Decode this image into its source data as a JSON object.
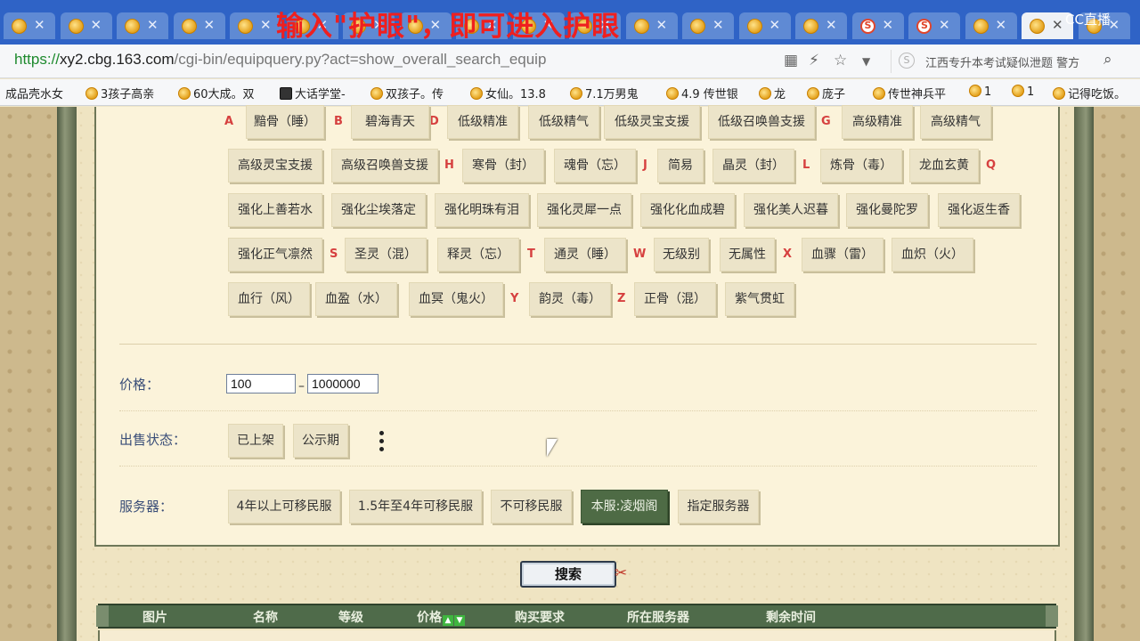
{
  "overlay_text": "输入\"护眼\"，即可进入护眼",
  "logo_text": "CC直播",
  "tabs": [
    {
      "icon": "favicon-icon"
    },
    {
      "icon": "favicon-icon"
    },
    {
      "icon": "favicon-icon"
    },
    {
      "icon": "favicon-icon"
    },
    {
      "icon": "favicon-icon"
    },
    {
      "icon": "favicon-icon"
    },
    {
      "icon": "favicon-icon"
    },
    {
      "icon": "favicon-icon"
    },
    {
      "icon": "favicon-icon"
    },
    {
      "icon": "favicon-icon"
    },
    {
      "icon": "favicon-icon"
    },
    {
      "icon": "favicon-icon"
    },
    {
      "icon": "favicon-icon"
    },
    {
      "icon": "favicon-icon"
    },
    {
      "icon": "favicon-icon"
    },
    {
      "icon": "favicon-icon"
    },
    {
      "icon": "favicon-icon"
    },
    {
      "icon": "favicon-icon"
    },
    {
      "icon": "favicon-icon"
    },
    {
      "icon": "favicon-icon"
    }
  ],
  "address": {
    "https": "https://",
    "host": "xy2.cbg.163.com",
    "path": "/cgi-bin/equipquery.py?act=show_overall_search_equip"
  },
  "search_box": {
    "text": "江西专升本考试疑似泄题 警方"
  },
  "bookmarks": [
    "成品壳水女",
    "3孩子高亲",
    "60大成。双",
    "大话学堂-",
    "双孩子。传",
    "女仙。13.8",
    "7.1万男鬼",
    "4.9 传世银",
    "龙",
    "庞子",
    "传世神兵平",
    "1",
    "1",
    "记得吃饭。"
  ],
  "attributes": {
    "letters": [
      "A",
      "B",
      "D",
      "G",
      "H",
      "J",
      "L",
      "Q",
      "S",
      "T",
      "W",
      "X",
      "Y",
      "Z"
    ],
    "buttons": [
      "黯骨（睡）",
      "碧海青天",
      "低级精准",
      "低级精气",
      "低级灵宝支援",
      "低级召唤兽支援",
      "高级精准",
      "高级精气",
      "高级灵宝支援",
      "高级召唤兽支援",
      "寒骨（封）",
      "魂骨（忘）",
      "简易",
      "晶灵（封）",
      "炼骨（毒）",
      "龙血玄黄",
      "强化上善若水",
      "强化尘埃落定",
      "强化明珠有泪",
      "强化灵犀一点",
      "强化化血成碧",
      "强化美人迟暮",
      "强化曼陀罗",
      "强化返生香",
      "强化正气凛然",
      "圣灵（混）",
      "释灵（忘）",
      "通灵（睡）",
      "无级别",
      "无属性",
      "血骤（雷）",
      "血炽（火）",
      "血行（风）",
      "血盈（水）",
      "血冥（鬼火）",
      "韵灵（毒）",
      "正骨（混）",
      "紫气贯虹"
    ]
  },
  "price": {
    "label": "价格：",
    "min": "100",
    "max": "1000000",
    "separator": "–"
  },
  "sale_status": {
    "label": "出售状态：",
    "options": [
      "已上架",
      "公示期"
    ]
  },
  "server": {
    "label": "服务器：",
    "options": [
      "4年以上可移民服",
      "1.5年至4年可移民服",
      "不可移民服",
      "本服:凌烟阁",
      "指定服务器"
    ],
    "selected": "本服:凌烟阁"
  },
  "search_button": "搜索",
  "results_header": [
    "图片",
    "名称",
    "等级",
    "价格",
    "购买要求",
    "所在服务器",
    "剩余时间"
  ]
}
